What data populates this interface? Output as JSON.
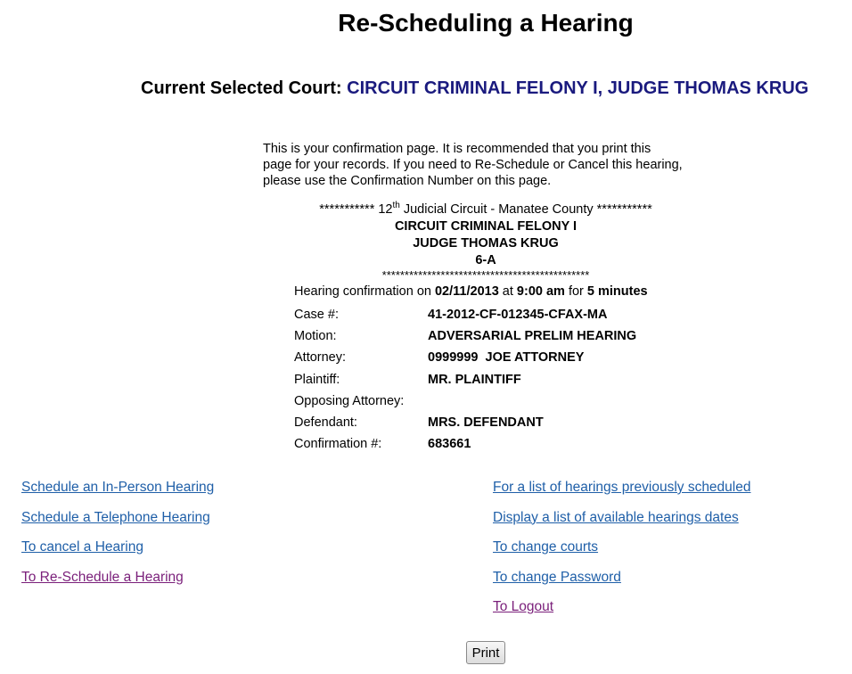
{
  "page": {
    "title": "Re-Scheduling a Hearing",
    "court_label": "Current Selected Court:",
    "court_name": "CIRCUIT CRIMINAL FELONY I, JUDGE THOMAS KRUG"
  },
  "intro": {
    "line1": "This is your confirmation page. It is recommended that you print this",
    "line2": "page for your records. If you need to Re-Schedule or Cancel this hearing,",
    "line3": "please use the Confirmation Number on this page."
  },
  "header_block": {
    "stars_prefix": "*********** 12",
    "superscript": "th",
    "circuit_text": " Judicial Circuit - Manatee County ***********",
    "division": "CIRCUIT CRIMINAL FELONY I",
    "judge": "JUDGE THOMAS KRUG",
    "room": "6-A",
    "stars_line": "**********************************************"
  },
  "confirmation": {
    "prefix": "Hearing confirmation on ",
    "date": "02/11/2013",
    "at": " at ",
    "time": "9:00 am",
    "for": " for ",
    "duration": "5 minutes",
    "fields": [
      {
        "label": "Case #:",
        "value": "41-2012-CF-012345-CFAX-MA"
      },
      {
        "label": "Motion:",
        "value": "ADVERSARIAL PRELIM HEARING"
      },
      {
        "label": "Attorney:",
        "value": "0999999  JOE ATTORNEY"
      },
      {
        "label": "Plaintiff:",
        "value": "MR. PLAINTIFF"
      },
      {
        "label": "Opposing Attorney:",
        "value": ""
      },
      {
        "label": "Defendant:",
        "value": "MRS. DEFENDANT"
      },
      {
        "label": "Confirmation #:",
        "value": "683661"
      }
    ]
  },
  "links_left": [
    {
      "label": "Schedule an In-Person Hearing",
      "visited": false
    },
    {
      "label": "Schedule a Telephone Hearing",
      "visited": false
    },
    {
      "label": "To cancel a Hearing",
      "visited": false
    },
    {
      "label": "To Re-Schedule a Hearing",
      "visited": true
    }
  ],
  "links_right": [
    {
      "label": "For a list of hearings previously scheduled",
      "visited": false
    },
    {
      "label": "Display a list of available hearings dates",
      "visited": false
    },
    {
      "label": "To change courts",
      "visited": false
    },
    {
      "label": "To change Password",
      "visited": false
    },
    {
      "label": "To Logout",
      "visited": true
    }
  ],
  "print_button": "Print",
  "colors": {
    "court_name": "#1a1a7e",
    "link": "#1f5fa8",
    "link_visited": "#7a1f7a"
  }
}
